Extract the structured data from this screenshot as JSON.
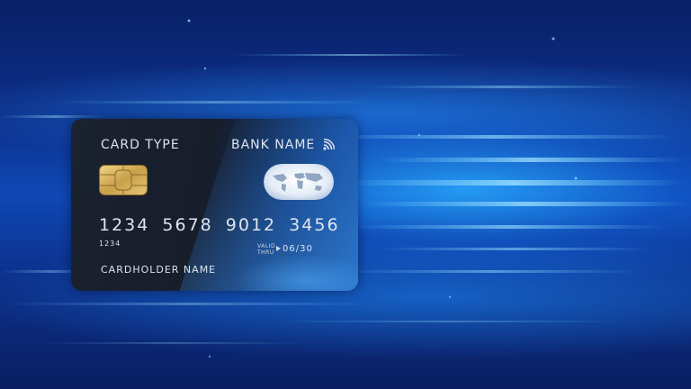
{
  "card": {
    "card_type_label": "CARD TYPE",
    "bank_name_label": "BANK NAME",
    "card_number": "1234  5678  9012  3456",
    "small_number": "1234",
    "valid_line_1": "VALID",
    "valid_line_2": "THRU",
    "expiry": "06/30",
    "cardholder_label": "CARDHOLDER NAME"
  },
  "icons": {
    "chip": "card-chip-icon",
    "globe": "world-map-globe-icon",
    "contactless": "contactless-wave-icon",
    "arrow": "arrow-right-icon"
  },
  "colors": {
    "background_dark": "#0a2066",
    "background_glow": "#28aaff",
    "card_body": "#1b2230",
    "card_text": "#dde4ef",
    "chip_gold": "#c9a04a"
  }
}
